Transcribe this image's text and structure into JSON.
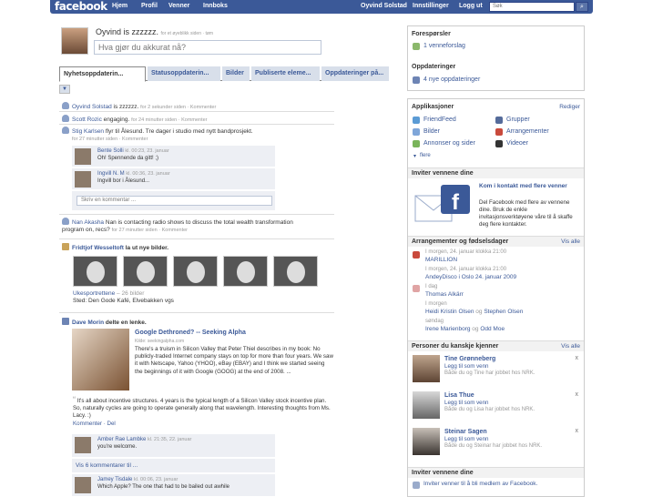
{
  "nav": {
    "logo": "facebook",
    "left": [
      "Hjem",
      "Profil",
      "Venner",
      "Innboks"
    ],
    "right": [
      "Oyvind Solstad",
      "Innstillinger",
      "Logg ut"
    ],
    "search_placeholder": "Søk"
  },
  "status": {
    "name": "Oyvind is zzzzzz.",
    "meta": "for et øyeblikk siden · tøm",
    "placeholder": "Hva gjør du akkurat nå?"
  },
  "tabs": [
    "Nyhetsoppdaterin...",
    "Statusoppdaterin...",
    "Bilder",
    "Publiserte eleme...",
    "Oppdateringer på..."
  ],
  "feed": {
    "s1": {
      "name": "Oyvind Solstad",
      "text": " is zzzzzz.",
      "meta": "for 2 sekunder siden · Kommenter"
    },
    "s2": {
      "name": "Scott Rozic",
      "text": " engaging.",
      "meta": "for 24 minutter siden · Kommenter"
    },
    "s3": {
      "name": "Stig Karlsen",
      "text": " flyr til Ålesund. Tre dager i studio med nytt bandprosjekt.",
      "meta": "for 27 minutter siden · Kommenter"
    },
    "c1": {
      "name": "Bente Solli",
      "meta": "kl. 00:23, 23. januar",
      "text": "Oh! Spennende da gitt! ;)"
    },
    "c2": {
      "name": "Ingvill N. M",
      "meta": "kl. 00:36, 23. januar",
      "text": "Ingvill bor i Ålesund..."
    },
    "comment_placeholder": "Skriv en kommentar ...",
    "s4": {
      "name": "Nan Akasha",
      "text": " Nan is contacting radio shows to discuss the total wealth transformation program on, recs?",
      "meta": "for 27 minutter siden · Kommenter"
    },
    "photos": {
      "name": "Fridtjof Wesseltoft",
      "text": " la ut nye bilder.",
      "album": "Ukesportrettene",
      "count": " – 26 bilder",
      "place": "Sted: Den Gode Kafé, Elvebakken vgs"
    },
    "link": {
      "name": "Dave Morin",
      "text": " delte en lenke."
    },
    "article": {
      "title": "Google Dethroned? -- Seeking Alpha",
      "source": "Kilde: seekingalpha.com",
      "body": "There's a truism in Silicon Valley that Peter Thiel describes in my book: No publicly-traded Internet company stays on top for more than four years. We saw it with Netscape, Yahoo (YHOO), eBay (EBAY) and I think we started seeing the beginnings of it with Google (GOOG) at the end of 2008. ...",
      "quote": "It's all about incentive structures. 4 years is the typical length of a Silicon Valley stock incentive plan. So, naturally cycles are going to operate generally along that wavelength. Interesting thoughts from Ms. Lacy. :)",
      "actions": "Kommenter · Del"
    },
    "c3": {
      "name": "Amber Rae Lambke",
      "meta": "kl. 21:35, 22. januar",
      "text": "you're welcome."
    },
    "show_all": "Vis 6 kommentarer til ...",
    "c4": {
      "name": "Jamey Tisdale",
      "meta": "kl. 00:06, 23. januar",
      "text": "Which Apple? The one that had to be bailed out awhile"
    }
  },
  "right": {
    "requests": {
      "title": "Forespørsler",
      "item": "1 venneforslag"
    },
    "updates": {
      "title": "Oppdateringer",
      "item": "4 nye oppdateringer"
    },
    "apps": {
      "title": "Applikasjoner",
      "edit": "Rediger",
      "items": [
        "FriendFeed",
        "Grupper",
        "Bilder",
        "Arrangementer",
        "Annonser og sider",
        "Videoer"
      ],
      "more": "flere"
    },
    "invite": {
      "title": "Inviter vennene dine",
      "headline": "Kom i kontakt med flere venner",
      "text": "Del Facebook med flere av vennene dine. Bruk de enkle invitasjonsverktøyene våre til å skaffe deg flere kontakter."
    },
    "events": {
      "title": "Arrangementer og fødselsdager",
      "see_all": "Vis alle",
      "e1_time": "I morgen, 24. januar klokka 21:00",
      "e1_name": "MARILLION",
      "e2_time": "I morgen, 24. januar klokka 21:00",
      "e2_name": "AndeyDisco i Oslo 24. januar 2009",
      "b1_day": "I dag",
      "b1_name": "Thomas Alkärr",
      "b2_day": "I morgen",
      "b2_name1": "Heidi Kristin Olsen",
      "b2_og": " og ",
      "b2_name2": "Stephen Olsen",
      "b3_day": "søndag",
      "b3_name1": "Irene Marienborg",
      "b3_og": " og ",
      "b3_name2": "Odd Moe"
    },
    "people": {
      "title": "Personer du kanskje kjenner",
      "see_all": "Vis alle",
      "add": "Legg til som venn",
      "p1": {
        "name": "Tine Grønneberg",
        "note": "Både du og Tine har jobbet hos NRK."
      },
      "p2": {
        "name": "Lisa Thue",
        "note": "Både du og Lisa har jobbet hos NRK."
      },
      "p3": {
        "name": "Steinar Sagen",
        "note": "Både du og Steinar har jobbet hos NRK."
      }
    },
    "invite2": {
      "title": "Inviter vennene dine",
      "text": "Inviter venner til å bli medlem av Facebook."
    }
  }
}
